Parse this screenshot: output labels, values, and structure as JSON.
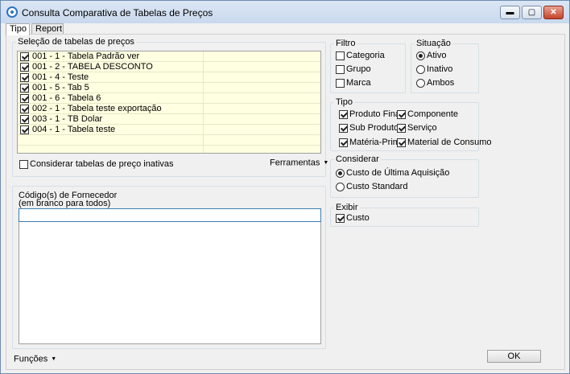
{
  "window": {
    "title": "Consulta Comparativa de Tabelas de Preços",
    "min_glyph": "▬",
    "max_glyph": "▢",
    "close_glyph": "✕"
  },
  "tabs": [
    {
      "label": "Tipo",
      "active": true
    },
    {
      "label": "Report",
      "active": false
    }
  ],
  "price_tables": {
    "label": "Seleção de tabelas de preços",
    "items": [
      {
        "label": "001 - 1 - Tabela Padrão ver",
        "checked": true
      },
      {
        "label": "001 - 2 - TABELA DESCONTO",
        "checked": true
      },
      {
        "label": "001 - 4 - Teste",
        "checked": true
      },
      {
        "label": "001 - 5 - Tab 5",
        "checked": true
      },
      {
        "label": "001 - 6 - Tabela 6",
        "checked": true
      },
      {
        "label": "002 - 1 - Tabela teste exportação",
        "checked": true
      },
      {
        "label": "003 - 1 - TB Dolar",
        "checked": true
      },
      {
        "label": "004 - 1 - Tabela teste",
        "checked": true
      }
    ],
    "inactive_label": "Considerar tabelas de preço inativas",
    "tools_label": "Ferramentas"
  },
  "supplier": {
    "label_line1": "Código(s) de Fornecedor",
    "label_line2": "(em branco para todos)",
    "value": ""
  },
  "functions_label": "Funções",
  "filtro": {
    "label": "Filtro",
    "options": [
      {
        "label": "Categoria",
        "checked": false
      },
      {
        "label": "Grupo",
        "checked": false
      },
      {
        "label": "Marca",
        "checked": false
      }
    ]
  },
  "situacao": {
    "label": "Situação",
    "options": [
      {
        "label": "Ativo",
        "selected": true
      },
      {
        "label": "Inativo",
        "selected": false
      },
      {
        "label": "Ambos",
        "selected": false
      }
    ]
  },
  "tipo": {
    "label": "Tipo",
    "options": [
      {
        "label": "Produto Final",
        "checked": true
      },
      {
        "label": "Componente",
        "checked": true
      },
      {
        "label": "Sub Produto",
        "checked": true
      },
      {
        "label": "Serviço",
        "checked": true
      },
      {
        "label": "Matéria-Prima",
        "checked": true
      },
      {
        "label": "Material de Consumo",
        "checked": true
      }
    ]
  },
  "considerar": {
    "label": "Considerar",
    "options": [
      {
        "label": "Custo de Última Aquisição",
        "selected": true
      },
      {
        "label": "Custo Standard",
        "selected": false
      }
    ]
  },
  "exibir": {
    "label": "Exibir",
    "options": [
      {
        "label": "Custo",
        "checked": true
      }
    ]
  },
  "ok_label": "OK"
}
